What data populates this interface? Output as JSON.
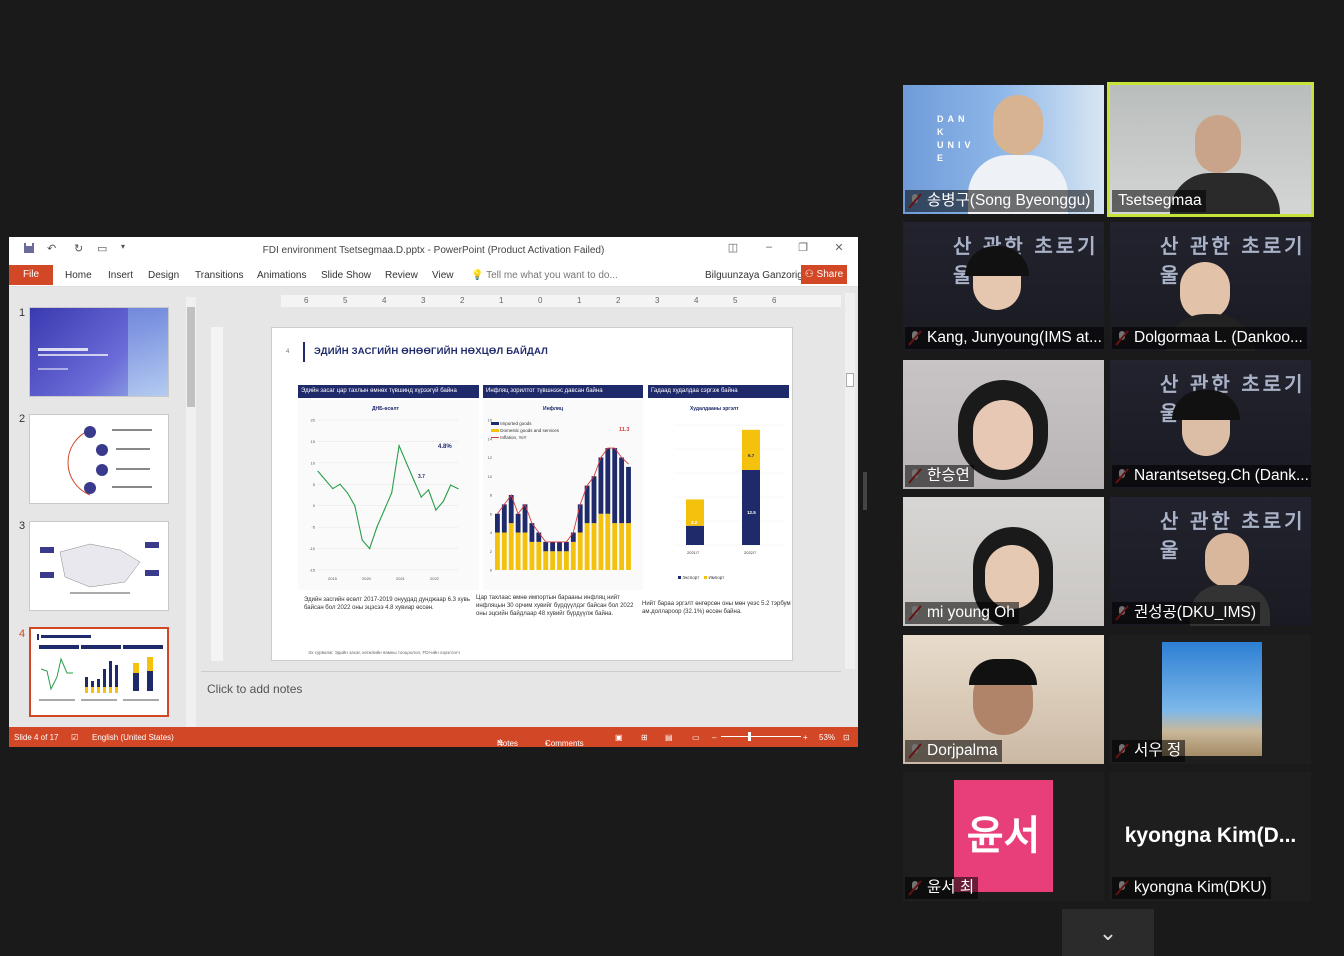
{
  "ppt": {
    "title": "FDI environment Tsetsegmaa.D.pptx - PowerPoint (Product Activation Failed)",
    "tabs": [
      "File",
      "Home",
      "Insert",
      "Design",
      "Transitions",
      "Animations",
      "Slide Show",
      "Review",
      "View"
    ],
    "tell_me": "Tell me what you want to do...",
    "user": "Bilguunzaya Ganzorig",
    "share": "Share",
    "thumb_numbers": [
      "1",
      "2",
      "3",
      "4"
    ],
    "notes_placeholder": "Click to add notes",
    "status": {
      "slide": "Slide 4 of 17",
      "language": "English (United States)",
      "notes": "Notes",
      "comments": "Comments",
      "zoom": "53%"
    },
    "ruler_ticks": [
      "6",
      "5",
      "4",
      "3",
      "2",
      "1",
      "0",
      "1",
      "2",
      "3",
      "4",
      "5",
      "6"
    ]
  },
  "slide": {
    "number": "4",
    "title": "ЭДИЙН ЗАСГИЙН ӨНӨӨГИЙН НӨХЦӨЛ БАЙДАЛ",
    "panels": [
      {
        "head": "Эдийн засаг цар тахлын өмнөх түвшинд хүрээгүй байна",
        "caption": "Эдийн засгийн өсөлт 2017-2019 онуудад дунджаар 6.3 хувь байсан бол 2022 оны эцэсээ 4.8 хувиар өссөн."
      },
      {
        "head": "Инфляц зорилтот түвшнээс давсан байна",
        "caption": "Цар тахлаас өмнө импортын барааны инфляц нийт инфляцын 30 орчим хувийг бүрдүүлдэг байсан бол 2022 оны эцсийн байдлаар 48 хувийг бүрдүүлж байна."
      },
      {
        "head": "Гадаад худалдаа сэргэж байна",
        "caption": "Нийт бараа эргэлт өнгөрсөн оны мөн үеэс 5.2 тэрбум ам.доллароор (32.1%) өссөн байна."
      }
    ],
    "gdp_chart_title": "ДНБ-өсөлт",
    "gdp_labels": [
      "4.8%",
      "3.7"
    ],
    "infl_chart_title": "Инфляц",
    "infl_legend": [
      "Imported goods",
      "Domestic goods and services",
      "Inflation, YoY"
    ],
    "infl_label": "11.3",
    "trade_chart_title": "Худалдааны эргэлт",
    "trade_legend": [
      "Экспорт",
      "Импорт"
    ],
    "trade_values": {
      "export_2021": "3.2",
      "import_2021": "4.4",
      "export_2022": "12.5",
      "import_2022": "6.7"
    },
    "trade_years": [
      "2021/7",
      "2022/7"
    ],
    "source": "Эх сурвалж: Эдийн засаг, хөгжлийн яамны тооцоолол, FDI-ийн хэрэглэгч"
  },
  "participants": [
    {
      "name": "송병구(Song Byeonggu)",
      "muted": true
    },
    {
      "name": "Tsetsegmaa",
      "muted": false,
      "active": true
    },
    {
      "name": "Kang, Junyoung(IMS at...",
      "muted": true
    },
    {
      "name": "Dolgormaa L. (Dankoo...",
      "muted": true
    },
    {
      "name": "한승연",
      "muted": true
    },
    {
      "name": "Narantsetseg.Ch (Dank...",
      "muted": true
    },
    {
      "name": "mi young Oh",
      "muted": true
    },
    {
      "name": "권성공(DKU_IMS)",
      "muted": true
    },
    {
      "name": "Dorjpalma",
      "muted": true
    },
    {
      "name": "서우 정",
      "muted": true
    },
    {
      "name": "윤서 최",
      "muted": true
    },
    {
      "name": "kyongna Kim(DKU)",
      "muted": true
    }
  ],
  "avatar_yunseo": "윤서",
  "kyongna_display": "kyongna  Kim(D...",
  "banner_text": "산 관한 초로기울",
  "dku_text": "DANK UNIVE",
  "accent_color": "#d24726",
  "active_speaker_color": "#c6e53a",
  "chart_data": [
    {
      "type": "line",
      "title": "ДНБ-өсөлт",
      "xlabel": "",
      "ylabel": "",
      "ylim": [
        -15,
        20
      ],
      "x_groups": [
        "2015",
        "2020",
        "2021",
        "2022"
      ],
      "series": [
        {
          "values": [
            8,
            6,
            4,
            5,
            3,
            0,
            -8,
            -10,
            -5,
            -1,
            3,
            14,
            10,
            6,
            2,
            3.7,
            -1,
            1,
            4.8,
            4
          ]
        }
      ]
    },
    {
      "type": "bar",
      "title": "Инфляц",
      "ylim": [
        0,
        16
      ],
      "series": [
        {
          "name": "Imported goods",
          "values": [
            2,
            3,
            3,
            2,
            3,
            2,
            1,
            1,
            1,
            1,
            1,
            1,
            3,
            4,
            5,
            6,
            7,
            8,
            7,
            6
          ]
        },
        {
          "name": "Domestic goods and services",
          "values": [
            4,
            4,
            5,
            4,
            4,
            3,
            3,
            2,
            2,
            2,
            2,
            3,
            4,
            5,
            5,
            6,
            6,
            5,
            5,
            5
          ]
        },
        {
          "name": "Inflation, YoY",
          "values": [
            6,
            7,
            8,
            6,
            7,
            5,
            4,
            3,
            3,
            3,
            3,
            4,
            7,
            9,
            10,
            12,
            13,
            13,
            12,
            11.3
          ]
        }
      ]
    },
    {
      "type": "bar",
      "title": "Худалдааны эргэлт",
      "categories": [
        "2021/7",
        "2022/7"
      ],
      "series": [
        {
          "name": "Экспорт",
          "values": [
            3.2,
            12.5
          ]
        },
        {
          "name": "Импорт",
          "values": [
            4.4,
            6.7
          ]
        }
      ]
    }
  ]
}
